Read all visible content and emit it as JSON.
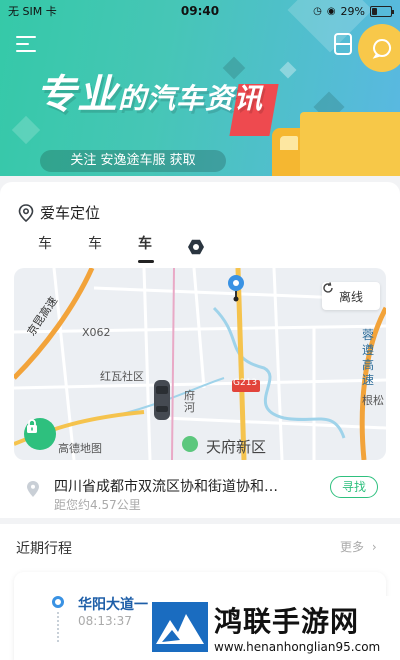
{
  "status_bar": {
    "carrier": "无 SIM 卡",
    "time": "09:40",
    "battery": "29%",
    "battery_level": 0.29
  },
  "banner": {
    "title_part1": "专业",
    "title_part2": "的",
    "title_part3": "汽车资讯",
    "subtitle": "关注 安逸途车服 获取",
    "accent_color": "#3ccaa9",
    "tag_color": "#ee4a4f"
  },
  "icons": {
    "menu": "menu-icon",
    "scan": "scan-icon",
    "chat": "chat-icon",
    "location": "location-pin-icon",
    "refresh": "refresh-icon",
    "lock": "lock-icon",
    "chevron": "chevron-right-icon"
  },
  "car_location": {
    "label": "爱车定位",
    "tabs": [
      {
        "label": "车"
      },
      {
        "label": "车"
      },
      {
        "label": "车"
      }
    ],
    "active_tab": 2
  },
  "map": {
    "offline_label": "离线",
    "labels": {
      "expressway": "京昆高速",
      "road_code": "X062",
      "district": "红瓦社区",
      "highway": "G213",
      "river": "府河",
      "new_area": "天府新区",
      "rongzun": "蓉遵高速",
      "genshi": "根松",
      "provider": "高德地图"
    }
  },
  "address": {
    "text": "四川省成都市双流区协和街道协和…",
    "distance": "距您约4.57公里",
    "find_label": "寻找"
  },
  "trips": {
    "title": "近期行程",
    "more_label": "更多",
    "items": [
      {
        "place": "华阳大道一",
        "time": "08:13:37"
      }
    ]
  },
  "watermark": {
    "name": "鸿联手游网",
    "url": "www.henanhonglian95.com"
  }
}
